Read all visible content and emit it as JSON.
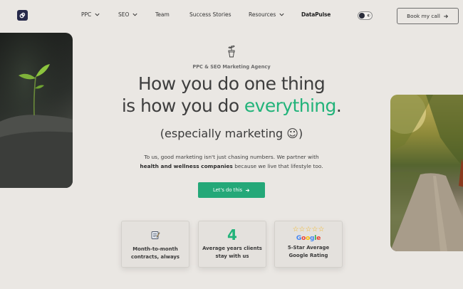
{
  "nav": {
    "items": [
      {
        "label": "PPC",
        "has_dropdown": true
      },
      {
        "label": "SEO",
        "has_dropdown": true
      },
      {
        "label": "Team",
        "has_dropdown": false
      },
      {
        "label": "Success Stories",
        "has_dropdown": false
      },
      {
        "label": "Resources",
        "has_dropdown": true
      }
    ],
    "brand": "DataPulse",
    "book_button": "Book my call"
  },
  "hero": {
    "eyebrow": "PPC & SEO Marketing Agency",
    "headline_line1": "How you do one thing",
    "headline_line2_prefix": "is how you do ",
    "headline_accent": "everything",
    "headline_suffix": ".",
    "subheadline": "(especially marketing ☺)",
    "body_line1": "To us, good marketing isn't just chasing numbers. We partner with",
    "body_bold": "health and wellness companies",
    "body_line2_rest": " because we live that lifestyle too.",
    "cta_label": "Let's do this"
  },
  "cards": [
    {
      "icon": "notepad-icon",
      "line1": "Month-to-month",
      "line2": "contracts, always"
    },
    {
      "value": "4",
      "line1": "Average years clients",
      "line2": "stay with us"
    },
    {
      "stars": "☆☆☆☆☆",
      "rating_logo": "Google",
      "line1": "5-Star Average",
      "line2": "Google Rating"
    }
  ],
  "colors": {
    "accent": "#22b37a",
    "cta": "#24a878",
    "background": "#eae7e3",
    "logo": "#26294a"
  }
}
